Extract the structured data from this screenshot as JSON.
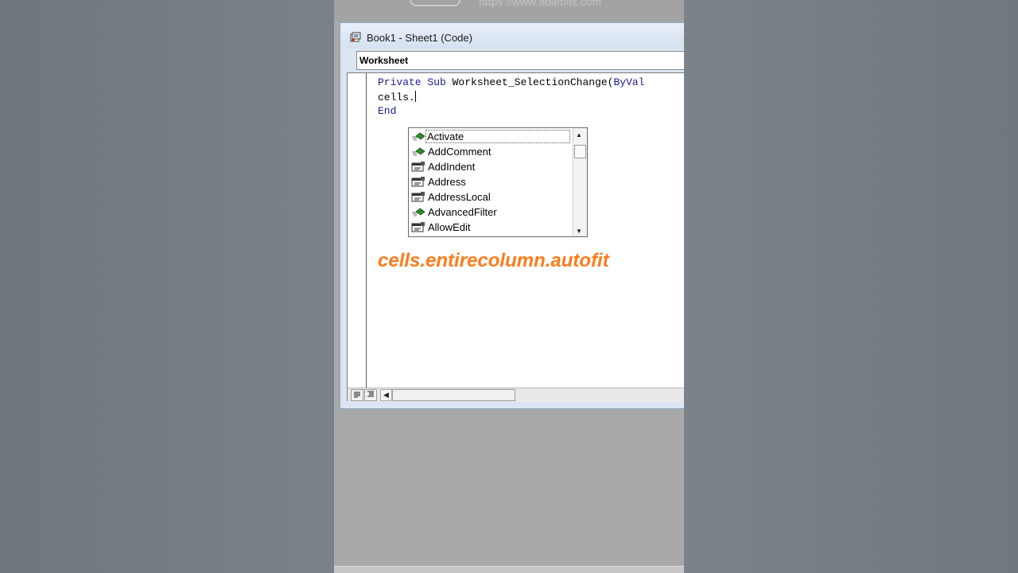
{
  "background": {
    "top_url": "https://www.ablebits.com"
  },
  "window": {
    "title": "Book1 - Sheet1 (Code)"
  },
  "object_combo": {
    "value": "Worksheet"
  },
  "code": {
    "line1_kw": "Private Sub",
    "line1_rest": " Worksheet_SelectionChange(",
    "line1_kw2": "ByVal",
    "line2": "cells.",
    "line3_kw": "End"
  },
  "autocomplete": {
    "items": [
      {
        "label": "Activate",
        "kind": "method-icon"
      },
      {
        "label": "AddComment",
        "kind": "method-icon"
      },
      {
        "label": "AddIndent",
        "kind": "property-icon"
      },
      {
        "label": "Address",
        "kind": "property-icon"
      },
      {
        "label": "AddressLocal",
        "kind": "property-icon"
      },
      {
        "label": "AdvancedFilter",
        "kind": "method-icon"
      },
      {
        "label": "AllowEdit",
        "kind": "property-icon"
      }
    ],
    "selected": "Activate",
    "scroll_up": "▲",
    "scroll_down": "▼"
  },
  "annotation": "cells.entirecolumn.autofit",
  "scrollbar": {
    "left_arrow": "◀"
  },
  "colors": {
    "annotation": "#ff7b1c",
    "keyword": "#1a1a8c"
  }
}
